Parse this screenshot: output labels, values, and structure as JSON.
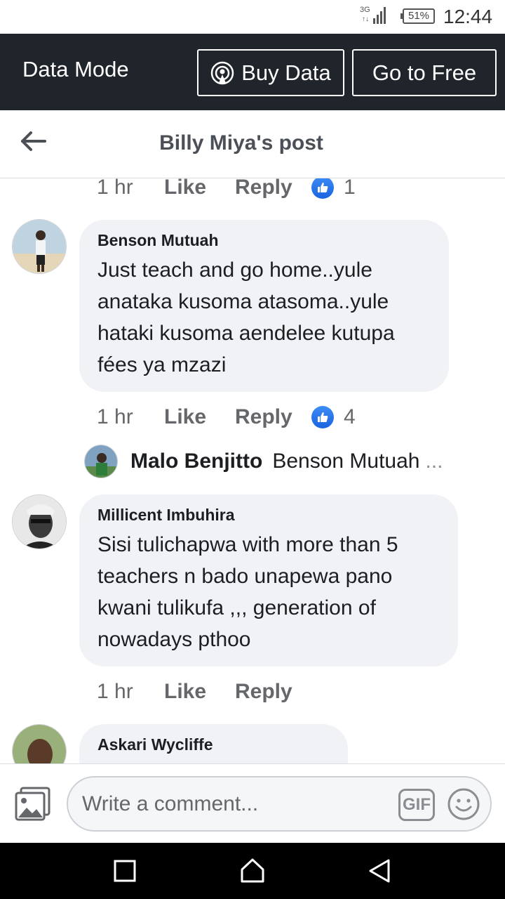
{
  "status_bar": {
    "network": "3G",
    "battery": "51%",
    "time": "12:44"
  },
  "data_mode": {
    "label": "Data Mode",
    "buy_label": "Buy Data",
    "free_label": "Go to Free"
  },
  "header": {
    "title": "Billy Miya's post"
  },
  "comments": [
    {
      "time": "1 hr",
      "like": "Like",
      "reply": "Reply",
      "reactions": "1"
    },
    {
      "author": "Benson Mutuah",
      "text_lines": [
        "Just teach and go home..yule",
        "anataka kusoma atasoma..yule",
        "hataki kusoma aendelee kutupa",
        "fées ya mzazi"
      ],
      "time": "1 hr",
      "like": "Like",
      "reply": "Reply",
      "reactions": "4"
    },
    {
      "author": "Millicent Imbuhira",
      "text_lines": [
        "Sisi tulichapwa with more than 5",
        "teachers n bado unapewa pano",
        "kwani tulikufa ,,, generation of",
        "nowadays pthoo"
      ],
      "time": "1 hr",
      "like": "Like",
      "reply": "Reply"
    },
    {
      "author": "Askari Wycliffe"
    }
  ],
  "reply_preview": {
    "author": "Malo Benjitto",
    "text": "Benson Mutuah",
    "ellipsis": "..."
  },
  "composer": {
    "placeholder": "Write a comment...",
    "gif_label": "GIF"
  },
  "colors": {
    "accent": "#1877f2",
    "topbar": "#20252b",
    "bubble": "#f0f2f5",
    "muted": "#65676b"
  },
  "icons": [
    "signal-icon",
    "battery-icon",
    "buy-data-icon",
    "back-arrow-icon",
    "like-icon",
    "photo-icon",
    "gif-icon",
    "emoji-icon",
    "recents-icon",
    "home-icon",
    "back-icon"
  ]
}
